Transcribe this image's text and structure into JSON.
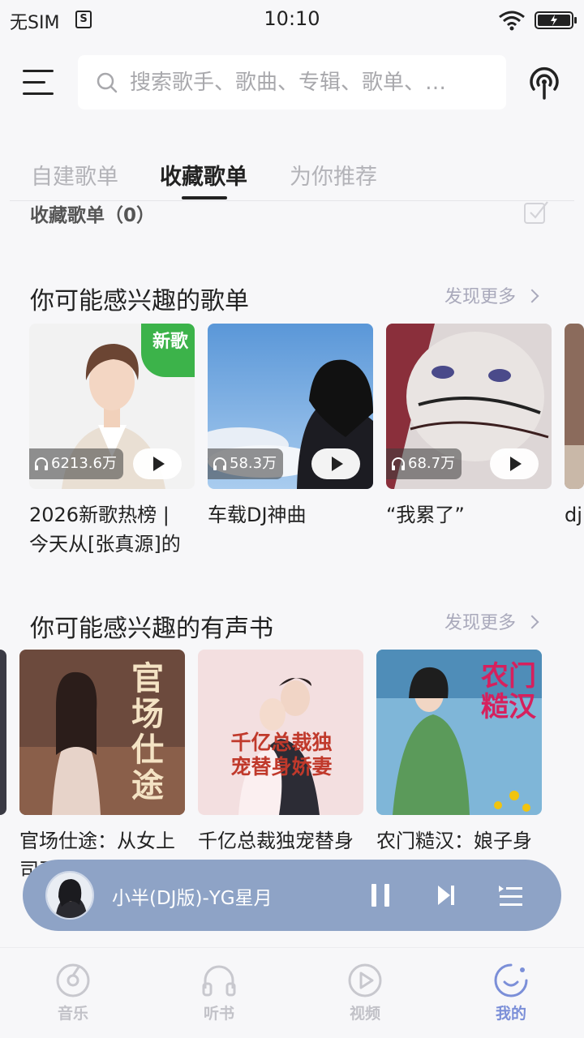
{
  "status_bar": {
    "carrier": "无SIM",
    "sim_icon": "S",
    "time": "10:10"
  },
  "search": {
    "placeholder": "搜索歌手、歌曲、专辑、歌单、…"
  },
  "tabs": [
    {
      "label": "自建歌单"
    },
    {
      "label": "收藏歌单"
    },
    {
      "label": "为你推荐"
    }
  ],
  "favorites": {
    "header": "收藏歌单（0）"
  },
  "playlist_section": {
    "title": "你可能感兴趣的歌单",
    "more": "发现更多",
    "items": [
      {
        "title": "2026新歌热榜 | 今天从[张真源]的",
        "play_count": "6213.6万",
        "badge": "新歌"
      },
      {
        "title": "车载DJ神曲",
        "play_count": "58.3万"
      },
      {
        "title": "“我累了”",
        "play_count": "68.7万"
      },
      {
        "title": "dj",
        "play_count": ""
      }
    ]
  },
  "audiobook_section": {
    "title": "你可能感兴趣的有声书",
    "more": "发现更多",
    "items": [
      {
        "title": "官场仕途：从女上司开始｜权力",
        "cover_text": "官场仕途"
      },
      {
        "title": "千亿总裁独宠替身娇妻[丑女逆袭]",
        "cover_text": "千亿总裁独宠替身娇妻"
      },
      {
        "title": "农门糙汉：娘子身软体娇",
        "cover_text": "农门糙汉"
      }
    ]
  },
  "mini_player": {
    "title": "小半(DJ版)-YG星月"
  },
  "bottom_nav": [
    {
      "label": "音乐",
      "icon": "music-disc-icon"
    },
    {
      "label": "听书",
      "icon": "headphones-icon"
    },
    {
      "label": "视频",
      "icon": "video-play-icon"
    },
    {
      "label": "我的",
      "icon": "profile-smile-icon",
      "active": true
    }
  ],
  "colors": {
    "accent": "#7b8fd8",
    "player_bg": "#8ea3c6",
    "new_badge": "#3cb34a"
  }
}
